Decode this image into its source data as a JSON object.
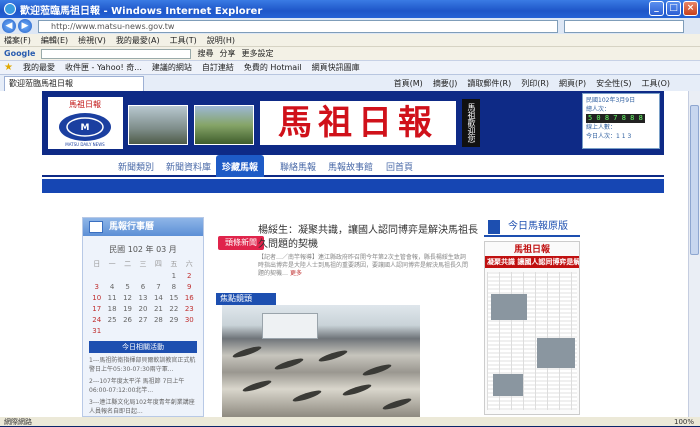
{
  "window": {
    "title": "歡迎蒞臨馬祖日報 - Windows Internet Explorer",
    "controls": [
      "minimize",
      "maximize",
      "close"
    ]
  },
  "address": {
    "url": "http://www.matsu-news.gov.tw",
    "search_placeholder": ""
  },
  "menu": [
    "檔案(F)",
    "編輯(E)",
    "檢視(V)",
    "我的最愛(A)",
    "工具(T)",
    "說明(H)"
  ],
  "google_toolbar": {
    "label": "Google",
    "buttons": [
      "搜尋",
      "分享",
      "更多設定"
    ]
  },
  "favorites_bar": {
    "label": "我的最愛",
    "items": [
      "收件匣 - Yahoo! 奇...",
      "建議的網站",
      "自訂連結",
      "免費的 Hotmail",
      "網頁快訊圖庫"
    ]
  },
  "tab": {
    "label": "歡迎蒞臨馬祖日報"
  },
  "commands": [
    "首頁(M)",
    "摘要(J)",
    "讀取郵件(R)",
    "列印(R)",
    "網頁(P)",
    "安全性(S)",
    "工具(O)"
  ],
  "site": {
    "brand": "馬祖日報",
    "logo_text": "馬祖日報",
    "logo_sub": "MATSU DAILY NEWS",
    "vertical_label": "馬祖歡迎您",
    "date_box": {
      "date": "民國102年3月9日",
      "visitors_label": "總人次：",
      "counter": "5 0 8 7 8 8 8",
      "online": "線上人數：",
      "today": "今日人次：1 1 3"
    },
    "nav": [
      "新聞類別",
      "新聞資料庫",
      "珍藏馬報",
      "聯絡馬報",
      "馬報故事館",
      "回首頁"
    ],
    "active_nav": "珍藏馬報"
  },
  "calendar": {
    "title": "馬報行事曆",
    "header": "民國 102 年 03 月",
    "weekdays": [
      "日",
      "一",
      "二",
      "三",
      "四",
      "五",
      "六"
    ],
    "days": [
      "",
      "",
      "",
      "",
      "",
      "1",
      "2",
      "3",
      "4",
      "5",
      "6",
      "7",
      "8",
      "9",
      "10",
      "11",
      "12",
      "13",
      "14",
      "15",
      "16",
      "17",
      "18",
      "19",
      "20",
      "21",
      "22",
      "23",
      "24",
      "25",
      "26",
      "27",
      "28",
      "29",
      "30",
      "31",
      "",
      "",
      "",
      "",
      "",
      ""
    ],
    "schedule_title": "今日相關活動",
    "schedule": [
      "1---馬祖防衛指揮部貝爾軟訓教官正式航警日上午05:30-07:30兩守軍...",
      "2---107年度太平洋 馬祖節 7日上午06:00-07:12:00北竿...",
      "3---連江縣文化局102年度青年創業講座人員報名自即日起..."
    ]
  },
  "headline": {
    "badge": "頭條新聞",
    "title": "楊綏生：凝聚共識，讓國人認同博弈是解決馬祖長久問題的契機",
    "body": "【記者…／南竿報導】連江縣政府昨召開今年第2次主管會報，縣長楊綏生致詞時指出博弈是大陸人士到馬祖的重要誘因，要讓國人認同博弈是解決馬祖長久問題的契機…",
    "more": "更多"
  },
  "focus": {
    "title": "焦點鏡頭"
  },
  "today_paper": {
    "title": "今日馬報原版",
    "masthead": "馬祖日報",
    "banner": "凝聚共識 讓國人認同博弈是解決馬祖長久問題的契機"
  },
  "status": {
    "left": "網際網路",
    "zoom": "100%"
  }
}
